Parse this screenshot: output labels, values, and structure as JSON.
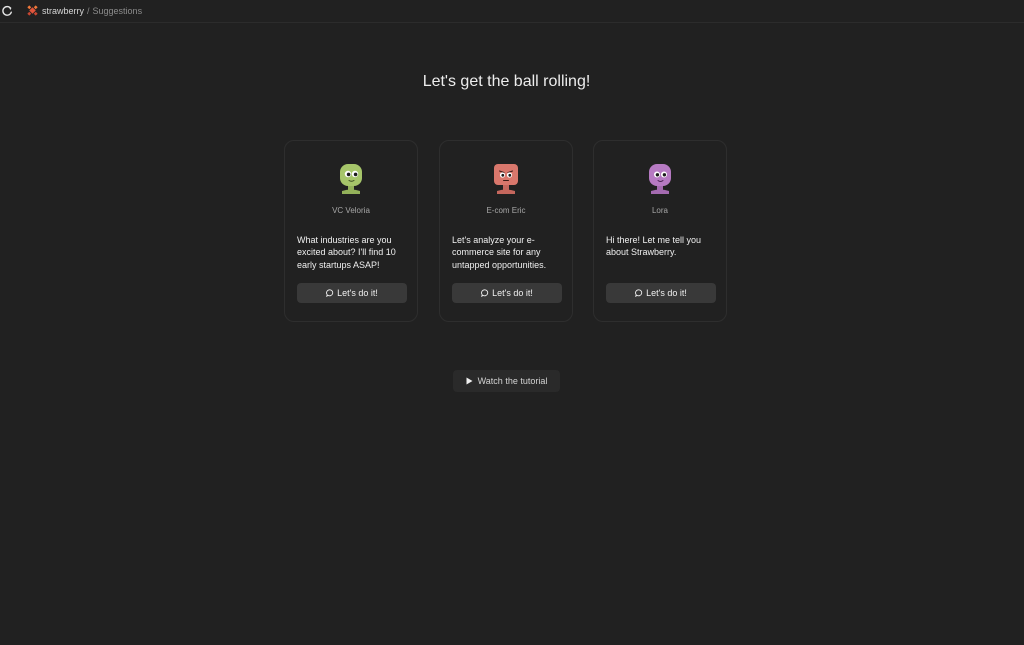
{
  "breadcrumb": {
    "app": "strawberry",
    "separator": "/",
    "page": "Suggestions"
  },
  "headline": "Let's get the ball rolling!",
  "cards": [
    {
      "name": "VC Veloria",
      "prompt": "What industries are you excited about? I'll find 10 early startups ASAP!",
      "cta": "Let's do it!",
      "avatar_icon": "green-persona-avatar",
      "avatar_color": "#a6c56a"
    },
    {
      "name": "E-com Eric",
      "prompt": "Let's analyze your e-commerce site for any untapped opportunities.",
      "cta": "Let's do it!",
      "avatar_icon": "red-persona-avatar",
      "avatar_color": "#d9776c"
    },
    {
      "name": "Lora",
      "prompt": "Hi there! Let me tell you about Strawberry.",
      "cta": "Let's do it!",
      "avatar_icon": "purple-persona-avatar",
      "avatar_color": "#b67ac2"
    }
  ],
  "tutorial_button": "Watch the tutorial",
  "colors": {
    "background": "#212121",
    "card_border": "#2e2e2e",
    "button": "#393939",
    "brand": "#e0553c"
  }
}
